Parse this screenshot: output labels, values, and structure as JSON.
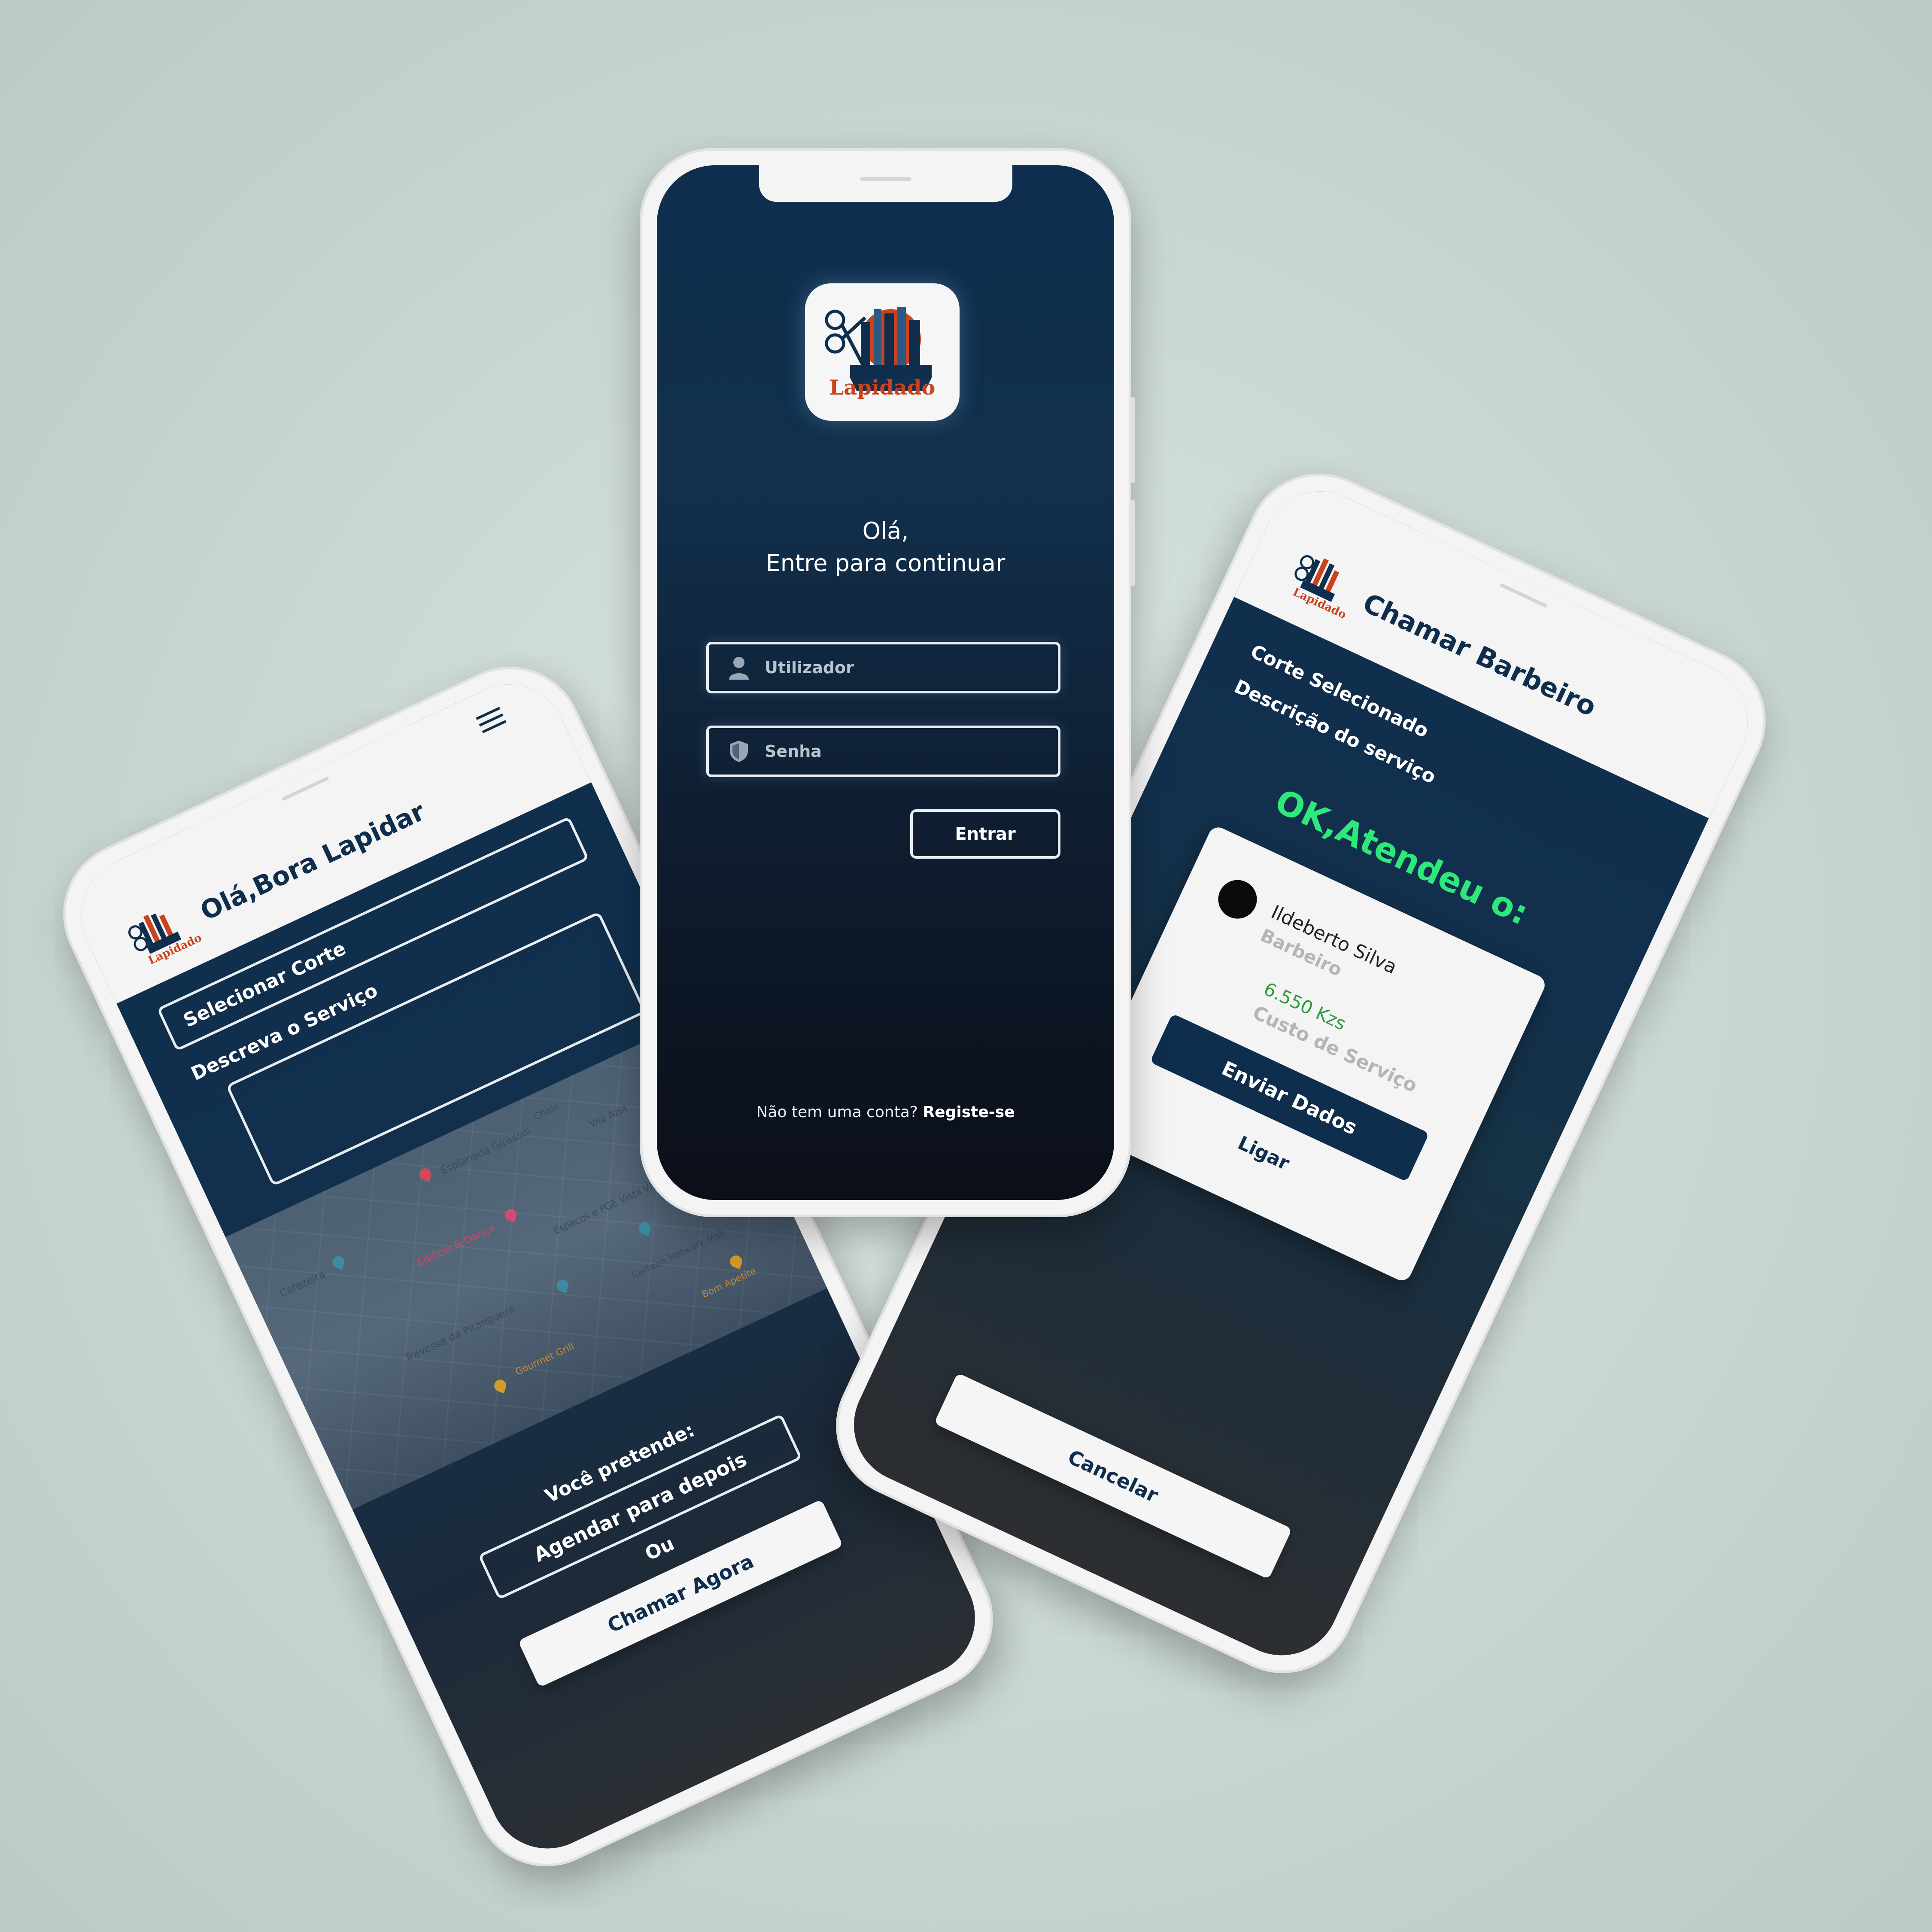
{
  "login": {
    "greeting_line1": "Olá,",
    "greeting_line2": "Entre para continuar",
    "username_placeholder": "Utilizador",
    "password_placeholder": "Senha",
    "enter_label": "Entrar",
    "no_account_text": "Não tem uma conta?",
    "register_link": "Registe-se",
    "logo_text": "Lapidado"
  },
  "booking": {
    "title": "Olá,Bora Lapidar",
    "logo_text": "Lapidado",
    "menu_icon": "hamburger-menu-icon",
    "select_cut_label": "Selecionar Corte",
    "describe_service_label": "Descreva o Serviço",
    "map_labels": [
      "Esplanada Girassol",
      "Cafezeira",
      "Edifício & Dança",
      "Travessa da Pitanguera",
      "Espaços e PGE Vista Villa Azul",
      "Cartoon Network Mall",
      "Vila Azul",
      "Gourmet Grill",
      "Bom Apetite",
      "Chalé"
    ],
    "intent_label": "Você pretende:",
    "schedule_label": "Agendar para depois",
    "or_label": "Ou",
    "call_now_label": "Chamar Agora"
  },
  "call": {
    "title": "Chamar Barbeiro",
    "logo_text": "Lapidado",
    "selected_cut_label": "Corte Selecionado",
    "service_desc_label": "Descrição do serviço",
    "status_heading": "OK,Atendeu o:",
    "barber_name": "Ildeberto Silva",
    "barber_role": "Barbeiro",
    "price": "6.550 Kzs",
    "price_caption": "Custo de Serviço",
    "send_data_label": "Enviar Dados",
    "call_label": "Ligar",
    "cancel_label": "Cancelar"
  },
  "colors": {
    "navy": "#0f2e4d",
    "accent_green": "#2ee87a",
    "price_green": "#2f9a3a",
    "logo_red": "#c9431f"
  }
}
